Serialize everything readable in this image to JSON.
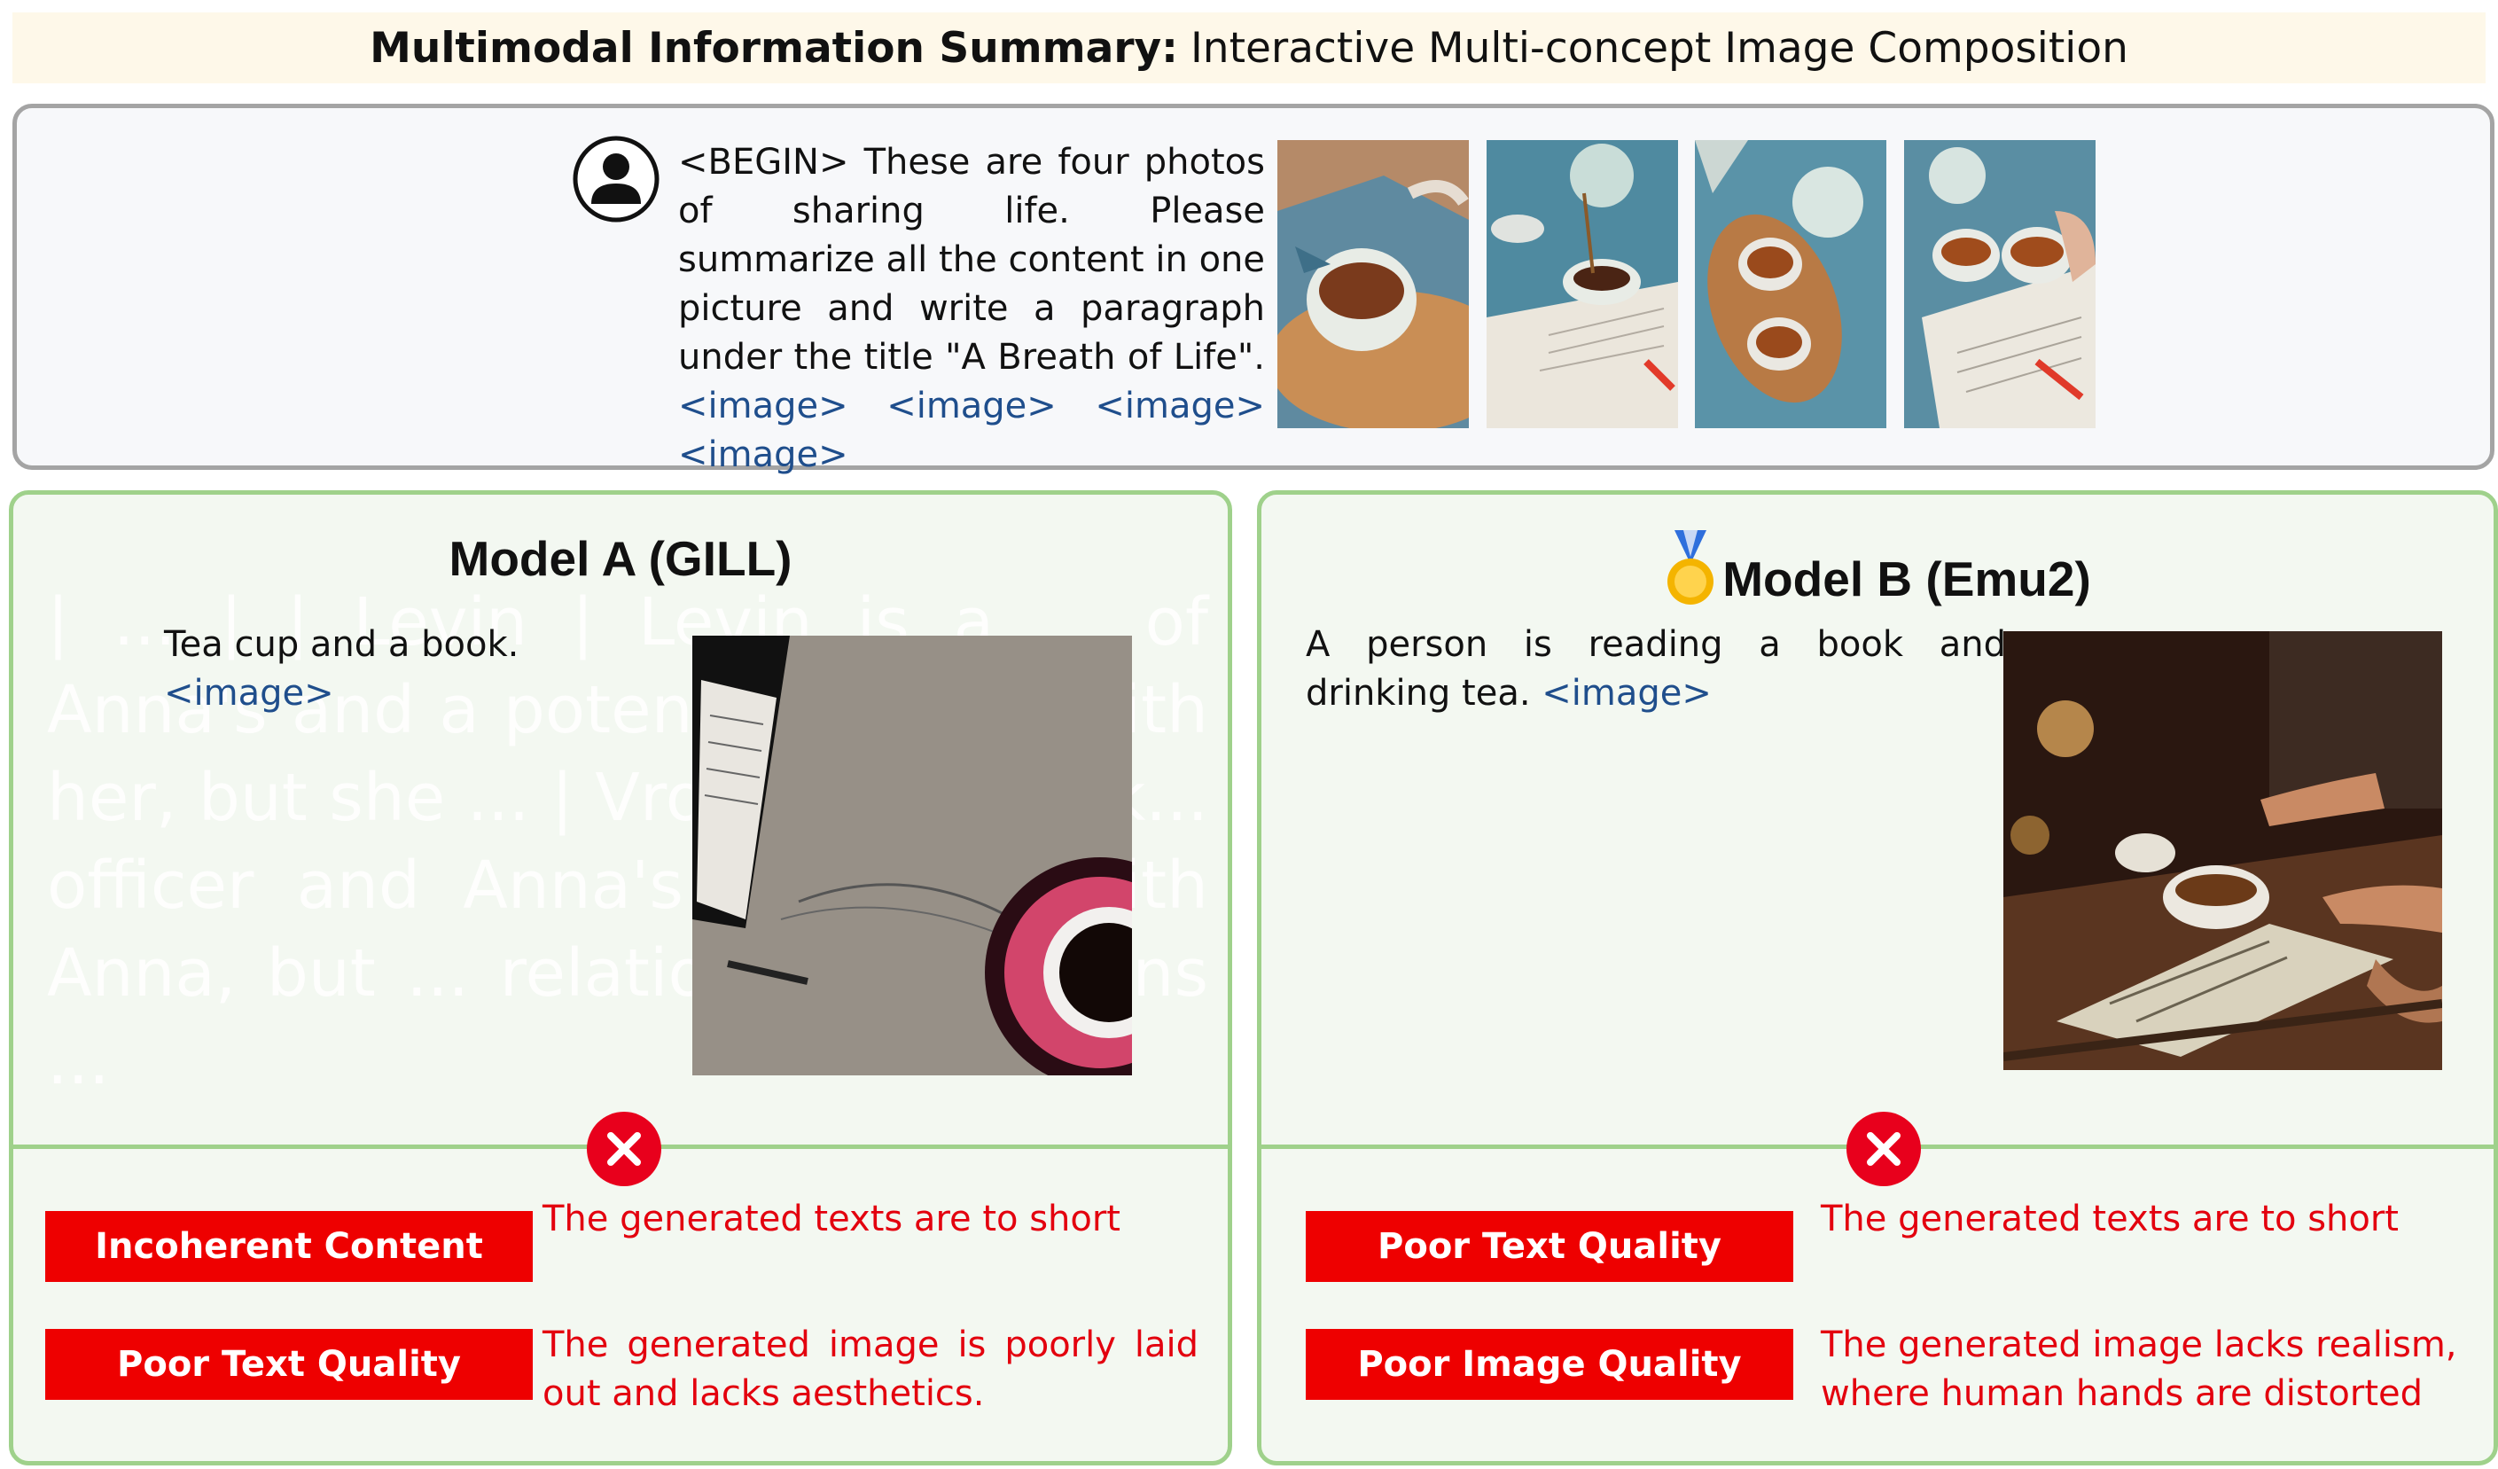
{
  "title": {
    "bold": "Multimodal Information Summary:",
    "rest": "Interactive Multi-concept Image Composition"
  },
  "prompt": {
    "text": "<BEGIN> These are four photos of sharing life. Please summarize all the content in one picture and write a paragraph under the title \"A Breath of Life\".",
    "image_tokens": [
      "<image>",
      "<image>",
      "<image>",
      "<image>"
    ],
    "thumbnails": [
      "tea-cup-on-wooden-tray",
      "teapot-pouring-over-book",
      "two-cups-on-wooden-tray",
      "hand-holding-cup-with-book"
    ]
  },
  "model_a": {
    "title": "Model A (GILL)",
    "response": "Tea cup and a book.",
    "image_token": "<image>",
    "ghost_text": "| ... | | Levin | Levin is a ... of Anna's and a potenti... in love with her, but she ... | Vronsky | Vronsk... officer and Anna's lo... love with Anna, but ... relationship is ... ons ...",
    "issues": [
      {
        "label": "Incoherent Content",
        "reason": "The generated texts are to short"
      },
      {
        "label": "Poor Text Quality",
        "reason": "The generated image is poorly laid out and lacks aesthetics."
      }
    ]
  },
  "model_b": {
    "title": "Model B (Emu2)",
    "medal_icon": "gold-medal-icon",
    "response": "A person is reading a book and drinking tea.",
    "image_token": "<image>",
    "issues": [
      {
        "label": "Poor Text Quality",
        "reason": "The generated texts are to short"
      },
      {
        "label": "Poor Image Quality",
        "reason": "The generated image lacks realism, where human hands are distorted"
      }
    ]
  },
  "colors": {
    "title_bg": "#fef8e9",
    "token": "#1f4e8c",
    "panel_border": "#9fd18b",
    "panel_bg": "#f3f8f1",
    "tag_red": "#ee0000",
    "reason_red": "#e3000e"
  }
}
